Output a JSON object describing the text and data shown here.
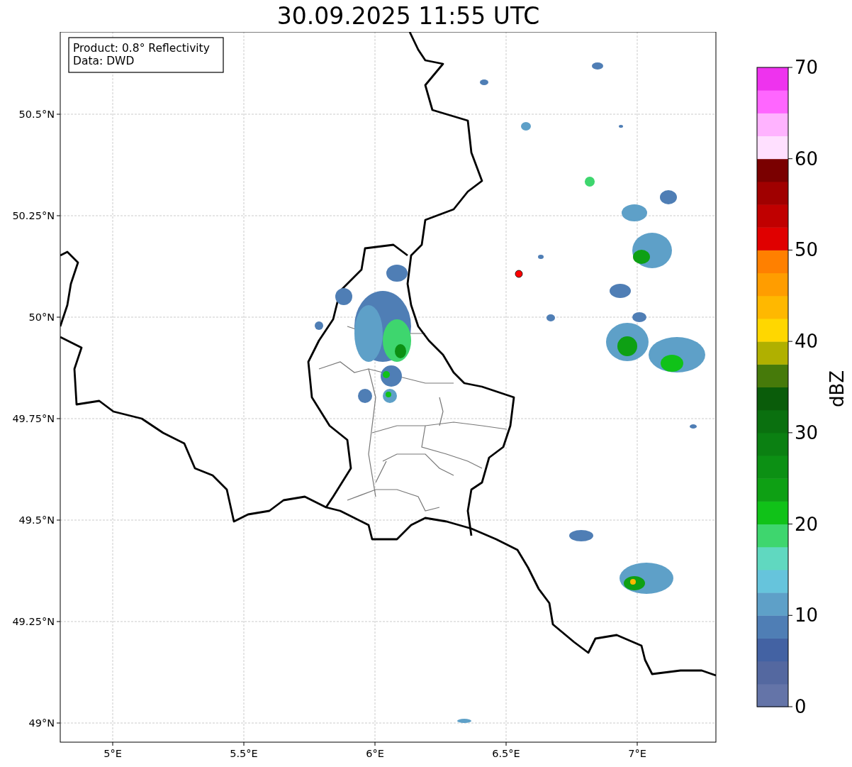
{
  "title": "30.09.2025 11:55 UTC",
  "info_box": {
    "lines": [
      "Product: 0.8° Reflectivity",
      "Data: DWD"
    ]
  },
  "map": {
    "x_ticks": [
      "5°E",
      "5.5°E",
      "6°E",
      "6.5°E",
      "7°E"
    ],
    "y_ticks": [
      "50.5°N",
      "50.25°N",
      "50°N",
      "49.75°N",
      "49.5°N",
      "49.25°N",
      "49°N"
    ]
  },
  "colorbar": {
    "label": "dBZ",
    "ticks": [
      "70",
      "60",
      "50",
      "40",
      "30",
      "20",
      "10",
      "0"
    ],
    "segments": [
      {
        "color": "#6474a8"
      },
      {
        "color": "#5468a0"
      },
      {
        "color": "#4362a3"
      },
      {
        "color": "#4f7eb5"
      },
      {
        "color": "#5ea0c8"
      },
      {
        "color": "#66c4dc"
      },
      {
        "color": "#60d8c0"
      },
      {
        "color": "#3ed66e"
      },
      {
        "color": "#10c218"
      },
      {
        "color": "#0ea014"
      },
      {
        "color": "#0c9014"
      },
      {
        "color": "#0b8012"
      },
      {
        "color": "#0a700f"
      },
      {
        "color": "#0a5c0a"
      },
      {
        "color": "#467a0a"
      },
      {
        "color": "#b0b000"
      },
      {
        "color": "#ffd700"
      },
      {
        "color": "#ffb800"
      },
      {
        "color": "#ff9d00"
      },
      {
        "color": "#ff8000"
      },
      {
        "color": "#e00000"
      },
      {
        "color": "#c00000"
      },
      {
        "color": "#a00000"
      },
      {
        "color": "#7a0000"
      },
      {
        "color": "#ffe0ff"
      },
      {
        "color": "#ffb3ff"
      },
      {
        "color": "#ff66ff"
      },
      {
        "color": "#ee33ee"
      }
    ]
  }
}
